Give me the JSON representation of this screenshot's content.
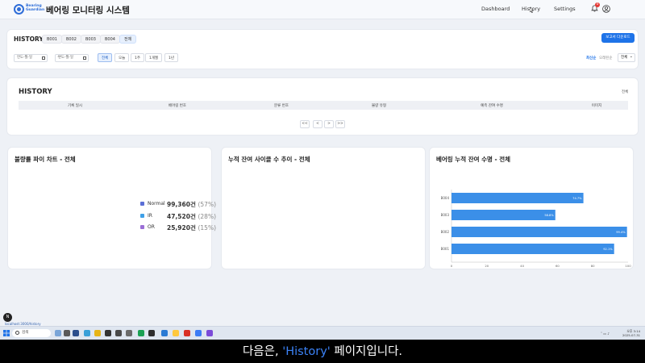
{
  "header": {
    "brand_line1": "Bearing",
    "brand_line2": "Guardian",
    "title": "베어링 모니터링 시스템",
    "nav": [
      "Dashboard",
      "History",
      "Settings"
    ],
    "notification_count": "0"
  },
  "filters": {
    "section_title": "HISTORY",
    "bearing_chips": [
      "B001",
      "B002",
      "B003",
      "B004",
      "전체"
    ],
    "active_chip": "전체",
    "download_label": "보고서 다운로드",
    "date_from_placeholder": "연도-월-일",
    "date_to_placeholder": "연도-월-일",
    "date_separator": "~",
    "range_buttons": [
      "전체",
      "오늘",
      "1주",
      "1개월",
      "1년"
    ],
    "active_range": "전체",
    "sort_primary": "최신순",
    "sort_secondary": "오래된순",
    "select_value": "전체"
  },
  "history_table": {
    "title": "HISTORY",
    "filter_label": "전체",
    "columns": [
      "기록 일시",
      "베어링 번호",
      "분류 번호",
      "불량 유형",
      "예측 잔여 수명",
      "이미지"
    ],
    "pager": [
      "<<",
      "<",
      ">",
      ">>"
    ]
  },
  "pie_card": {
    "title": "불량률 파이 차트 - 전체",
    "legend": [
      {
        "name": "Normal",
        "count": "99,360건",
        "pct": "(57%)",
        "color": "#5b6fd6"
      },
      {
        "name": "IR",
        "count": "47,520건",
        "pct": "(28%)",
        "color": "#3fa0e8"
      },
      {
        "name": "OR",
        "count": "25,920건",
        "pct": "(15%)",
        "color": "#9b6fd6"
      }
    ]
  },
  "trend_card": {
    "title": "누적 잔여 사이클 수 추이 - 전체"
  },
  "life_card": {
    "title": "베어링 누적 잔여 수명 - 전체"
  },
  "chart_data": {
    "type": "bar",
    "orientation": "horizontal",
    "title": "베어링 누적 잔여 수명 - 전체",
    "categories": [
      "B004",
      "B003",
      "B002",
      "B001"
    ],
    "values": [
      74.7,
      58.8,
      99.4,
      92.1
    ],
    "value_labels": [
      "74.7%",
      "58.8%",
      "99.4%",
      "92.1%"
    ],
    "xlim": [
      0,
      100
    ],
    "xticks": [
      "0",
      "20",
      "40",
      "60",
      "80",
      "100"
    ],
    "bar_color": "#3b8fe8",
    "grid": false
  },
  "overlay": {
    "avatar_letter": "N",
    "status_url": "localhost:3000/history"
  },
  "taskbar": {
    "search_placeholder": "검색",
    "time": "오후 3:14",
    "date": "2025-07-31"
  },
  "subtitle": {
    "before": "다음은, ",
    "highlight": "'History'",
    "after": " 페이지입니다."
  }
}
